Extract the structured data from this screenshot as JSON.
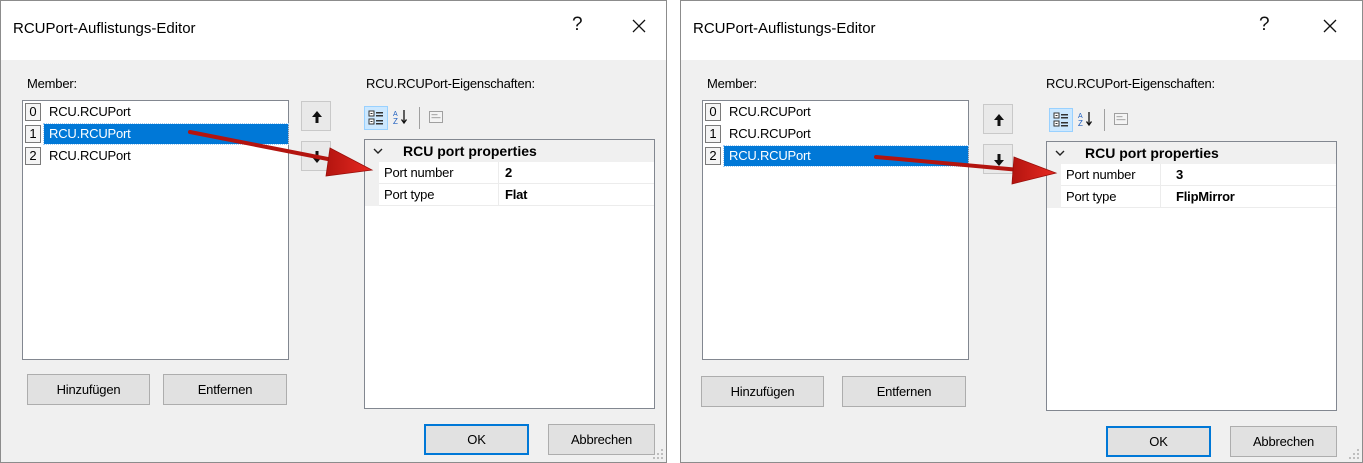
{
  "dialogs": [
    {
      "title": "RCUPort-Auflistungs-Editor",
      "help_label": "?",
      "members_label": "Member:",
      "props_label": "RCU.RCUPort-Eigenschaften:",
      "items": [
        {
          "index": "0",
          "label": "RCU.RCUPort"
        },
        {
          "index": "1",
          "label": "RCU.RCUPort"
        },
        {
          "index": "2",
          "label": "RCU.RCUPort"
        }
      ],
      "selected_index": 1,
      "add_label": "Hinzufügen",
      "remove_label": "Entfernen",
      "ok_label": "OK",
      "cancel_label": "Abbrechen",
      "category": "RCU port properties",
      "properties": [
        {
          "name": "Port number",
          "value": "2"
        },
        {
          "name": "Port type",
          "value": "Flat"
        }
      ]
    },
    {
      "title": "RCUPort-Auflistungs-Editor",
      "help_label": "?",
      "members_label": "Member:",
      "props_label": "RCU.RCUPort-Eigenschaften:",
      "items": [
        {
          "index": "0",
          "label": "RCU.RCUPort"
        },
        {
          "index": "1",
          "label": "RCU.RCUPort"
        },
        {
          "index": "2",
          "label": "RCU.RCUPort"
        }
      ],
      "selected_index": 2,
      "add_label": "Hinzufügen",
      "remove_label": "Entfernen",
      "ok_label": "OK",
      "cancel_label": "Abbrechen",
      "category": "RCU port properties",
      "properties": [
        {
          "name": "Port number",
          "value": "3"
        },
        {
          "name": "Port type",
          "value": "FlipMirror"
        }
      ]
    }
  ],
  "icons": {
    "close": "close-icon",
    "move_up": "arrow-up-icon",
    "move_down": "arrow-down-icon",
    "categorized": "categorized-view-icon",
    "alphabetical": "alphabetical-sort-icon",
    "property_pages": "property-pages-icon",
    "collapse": "chevron-down-icon",
    "annotation": "red-arrow-annotation-icon"
  },
  "colors": {
    "selection": "#0078d7",
    "annotation": "#e11d16",
    "dialog_bg": "#f0f0f0"
  }
}
